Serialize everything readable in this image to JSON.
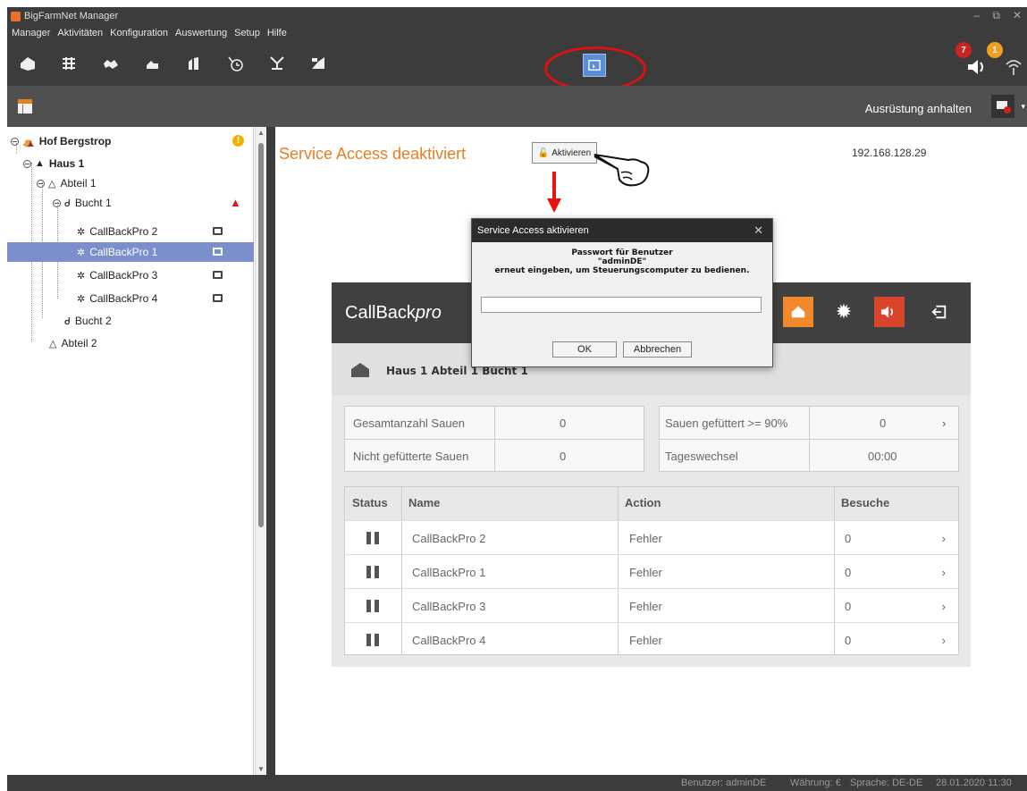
{
  "window": {
    "title": "BigFarmNet Manager",
    "controls": [
      "–",
      "⧉",
      "✕"
    ]
  },
  "menu": [
    "Manager",
    "Aktivitäten",
    "Konfiguration",
    "Auswertung",
    "Setup",
    "Hilfe"
  ],
  "toolbar": {
    "icons": [
      "barn-icon",
      "grid-icon",
      "pigs-icon",
      "pig-icon",
      "silo-icon",
      "schedule-icon",
      "scale-icon",
      "feed-icon"
    ],
    "notifications": {
      "alarm_count": "7",
      "warning_count": "1"
    }
  },
  "subbar": {
    "halt_label": "Ausrüstung anhalten"
  },
  "tree": {
    "nodes": [
      {
        "label": "Hof Bergstrop",
        "bold": true
      },
      {
        "label": "Haus 1",
        "bold": true
      },
      {
        "label": "Abteil 1"
      },
      {
        "label": "Bucht 1"
      },
      {
        "label": "CallBackPro 2"
      },
      {
        "label": "CallBackPro 1",
        "selected": true
      },
      {
        "label": "CallBackPro 3"
      },
      {
        "label": "CallBackPro 4"
      },
      {
        "label": "Bucht 2"
      },
      {
        "label": "Abteil 2"
      }
    ]
  },
  "main": {
    "service_access_title": "Service Access deaktiviert",
    "activate_label": "Aktivieren",
    "ip": "192.168.128.29"
  },
  "callback": {
    "logo_prefix": "CallBack",
    "logo_suffix": "pro",
    "breadcrumb": "Haus 1 Abteil 1 Bucht 1",
    "stats_left": [
      {
        "label": "Gesamtanzahl Sauen",
        "value": "0"
      },
      {
        "label": "Nicht gefütterte Sauen",
        "value": "0"
      }
    ],
    "stats_right": [
      {
        "label": "Sauen gefüttert >= 90%",
        "value": "0"
      },
      {
        "label": "Tageswechsel",
        "value": "00:00"
      }
    ],
    "table_headers": {
      "status": "Status",
      "name": "Name",
      "action": "Action",
      "visits": "Besuche"
    },
    "rows": [
      {
        "name": "CallBackPro 2",
        "action": "Fehler",
        "visits": "0"
      },
      {
        "name": "CallBackPro 1",
        "action": "Fehler",
        "visits": "0"
      },
      {
        "name": "CallBackPro 3",
        "action": "Fehler",
        "visits": "0"
      },
      {
        "name": "CallBackPro 4",
        "action": "Fehler",
        "visits": "0"
      }
    ]
  },
  "modal": {
    "title": "Service Access aktivieren",
    "line1": "Passwort für Benutzer",
    "line2": "\"adminDE\"",
    "line3": "erneut eingeben, um Steuerungscomputer zu bedienen.",
    "ok": "OK",
    "cancel": "Abbrechen"
  },
  "statusbar": {
    "user": "Benutzer: adminDE",
    "currency": "Währung: €",
    "language": "Sprache: DE-DE",
    "datetime": "28.01.2020  11:30"
  },
  "colors": {
    "accent": "#e67e22",
    "selected": "#7a8fcc",
    "alarm": "#cc2222",
    "warning": "#f0a020"
  }
}
